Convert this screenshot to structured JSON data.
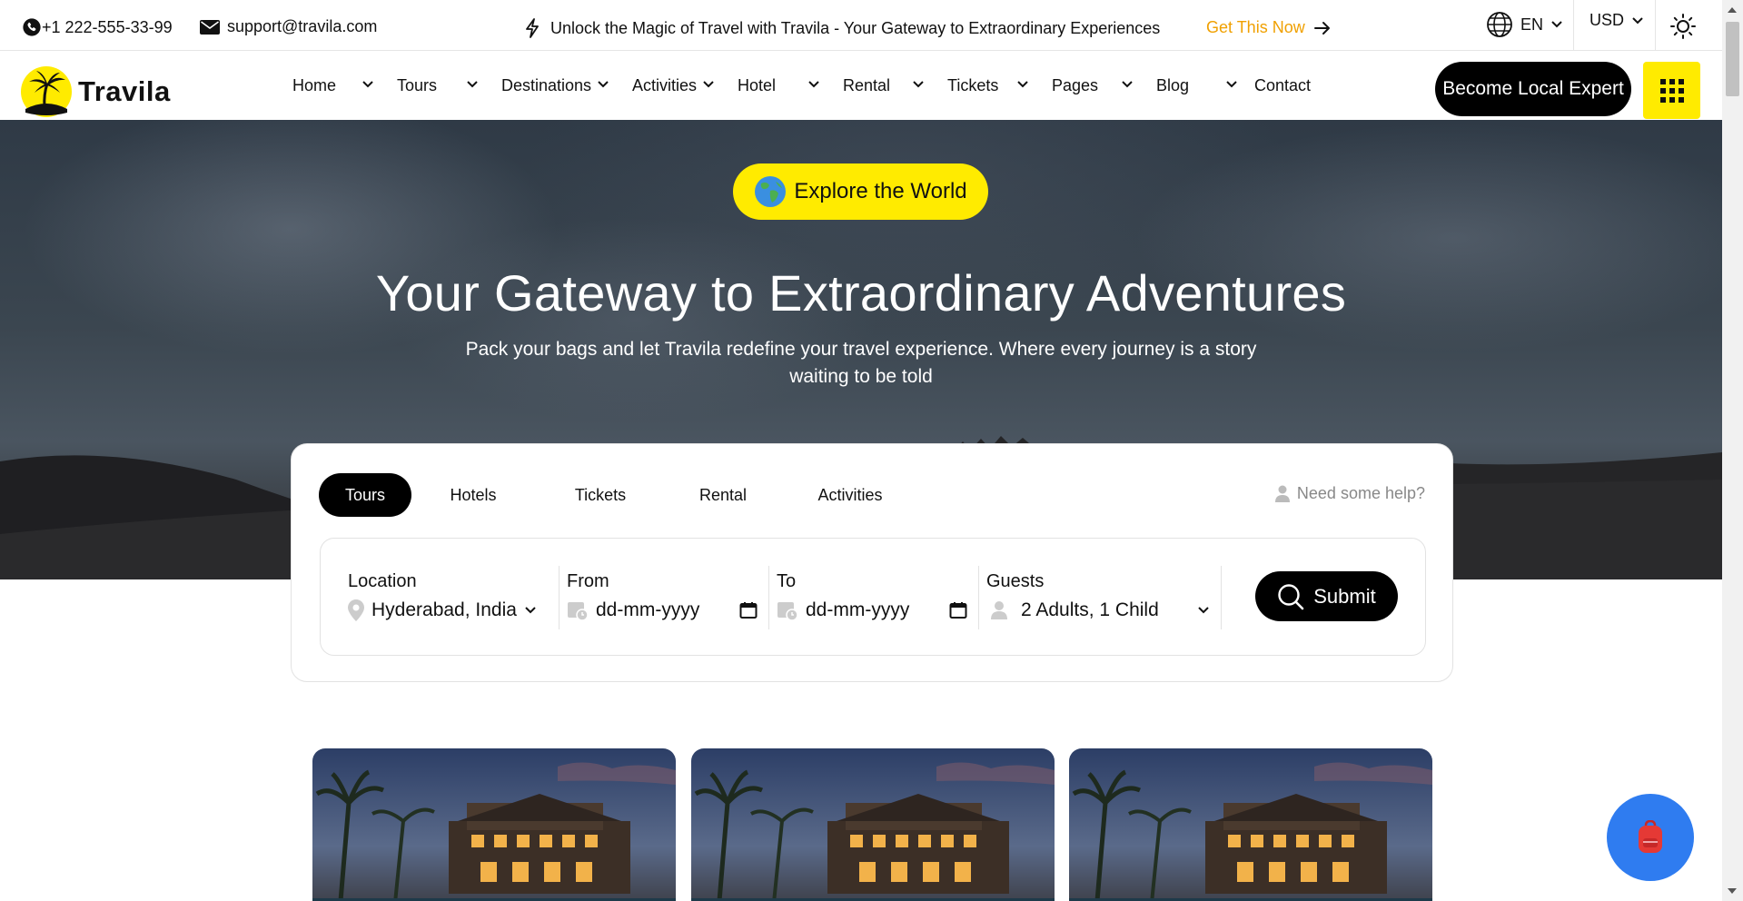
{
  "topbar": {
    "phone": "+1 222-555-33-99",
    "email": "support@travila.com",
    "promo": "Unlock the Magic of Travel with Travila - Your Gateway to Extraordinary Experiences",
    "cta": "Get This Now",
    "language": "EN",
    "currency": "USD"
  },
  "brand": {
    "name": "Travila"
  },
  "nav": {
    "items": [
      {
        "label": "Home"
      },
      {
        "label": "Tours"
      },
      {
        "label": "Destinations"
      },
      {
        "label": "Activities"
      },
      {
        "label": "Hotel"
      },
      {
        "label": "Rental"
      },
      {
        "label": "Tickets"
      },
      {
        "label": "Pages"
      },
      {
        "label": "Blog"
      },
      {
        "label": "Contact"
      }
    ],
    "expert_button": "Become Local Expert"
  },
  "hero": {
    "badge": "Explore the World",
    "title": "Your Gateway to Extraordinary Adventures",
    "subtitle": "Pack your bags and let Travila redefine your travel experience. Where every journey is a story waiting to be told"
  },
  "search": {
    "tabs": [
      {
        "label": "Tours",
        "active": true
      },
      {
        "label": "Hotels"
      },
      {
        "label": "Tickets"
      },
      {
        "label": "Rental"
      },
      {
        "label": "Activities"
      }
    ],
    "help": "Need some help?",
    "location": {
      "label": "Location",
      "value": "Hyderabad, India"
    },
    "from": {
      "label": "From",
      "placeholder": "dd-mm-yyyy"
    },
    "to": {
      "label": "To",
      "placeholder": "dd-mm-yyyy"
    },
    "guests": {
      "label": "Guests",
      "value": "2 Adults, 1 Child"
    },
    "submit": "Submit"
  },
  "colors": {
    "accent_yellow": "#ffeb00",
    "cta_orange": "#f0a000",
    "fab_blue": "#2f7cf0",
    "dark": "#000000"
  }
}
